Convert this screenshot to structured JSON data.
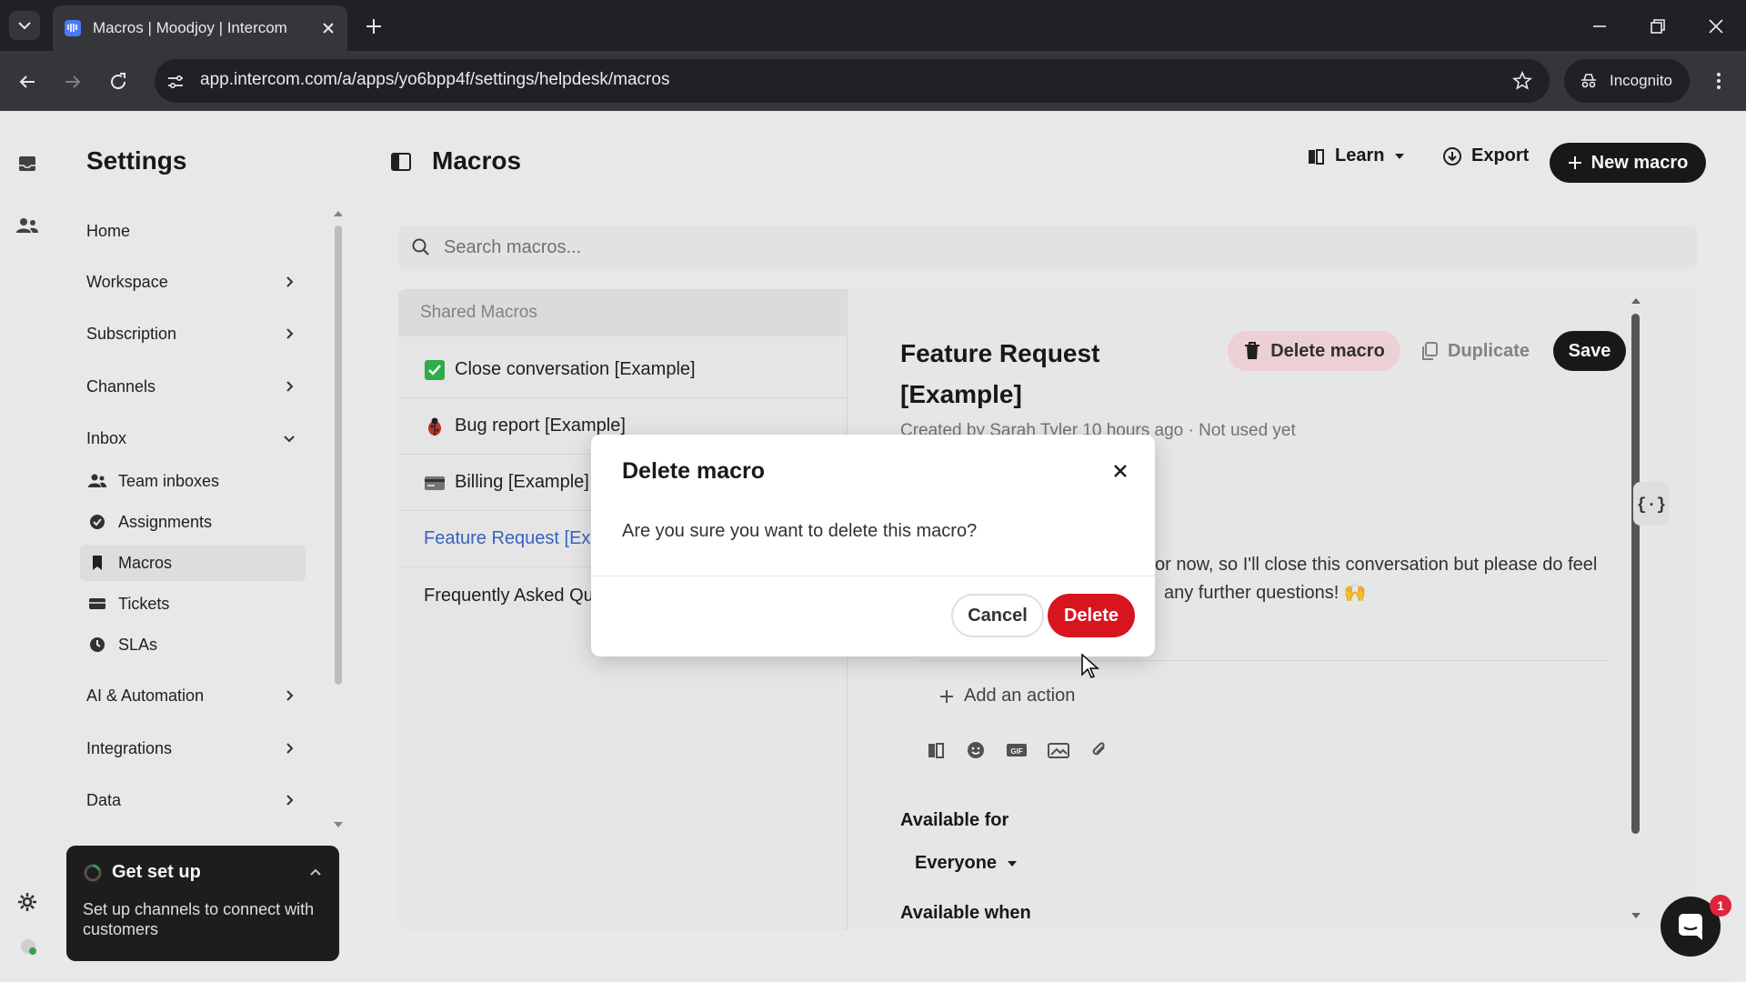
{
  "browser": {
    "tab_title": "Macros | Moodjoy | Intercom",
    "url": "app.intercom.com/a/apps/yo6bpp4f/settings/helpdesk/macros",
    "incognito_label": "Incognito"
  },
  "settings_nav": {
    "title": "Settings",
    "items": [
      {
        "label": "Home"
      },
      {
        "label": "Workspace"
      },
      {
        "label": "Subscription"
      },
      {
        "label": "Channels"
      },
      {
        "label": "Inbox"
      },
      {
        "label": "AI & Automation"
      },
      {
        "label": "Integrations"
      },
      {
        "label": "Data"
      }
    ],
    "inbox_sub": [
      {
        "label": "Team inboxes",
        "icon": "team-icon"
      },
      {
        "label": "Assignments",
        "icon": "assignment-icon"
      },
      {
        "label": "Macros",
        "icon": "bookmark-icon"
      },
      {
        "label": "Tickets",
        "icon": "ticket-icon"
      },
      {
        "label": "SLAs",
        "icon": "sla-icon"
      }
    ]
  },
  "get_setup": {
    "title": "Get set up",
    "text": "Set up channels to connect with customers"
  },
  "header": {
    "title": "Macros",
    "learn_label": "Learn",
    "export_label": "Export",
    "new_macro_label": "New macro"
  },
  "search": {
    "placeholder": "Search macros..."
  },
  "macro_list": {
    "header": "Shared Macros",
    "items": [
      {
        "label": "Close conversation [Example]",
        "icon": "check-emoji"
      },
      {
        "label": "Bug report [Example]",
        "icon": "bug-emoji"
      },
      {
        "label": "Billing [Example]",
        "icon": "card-emoji"
      },
      {
        "label": "Feature Request [Example]",
        "icon": ""
      },
      {
        "label": "Frequently Asked Questions",
        "icon": ""
      }
    ]
  },
  "detail": {
    "title": "Feature Request [Example]",
    "delete_macro_label": "Delete macro",
    "duplicate_label": "Duplicate",
    "save_label": "Save",
    "meta": "Created by  Sarah Tyler 10 hours ago · Not used yet",
    "message_line1": "or now, so I'll close this conversation but please do feel",
    "message_line2": "any further questions! 🙌",
    "add_action_label": "Add an action",
    "available_for_label": "Available for",
    "available_for_value": "Everyone",
    "available_when_label": "Available when"
  },
  "modal": {
    "title": "Delete macro",
    "body": "Are you sure you want to delete this macro?",
    "cancel_label": "Cancel",
    "delete_label": "Delete"
  },
  "messenger": {
    "badge_count": "1"
  },
  "colors": {
    "danger": "#d8141f",
    "active_link": "#3a66c7",
    "dark": "#1a1a1a"
  }
}
